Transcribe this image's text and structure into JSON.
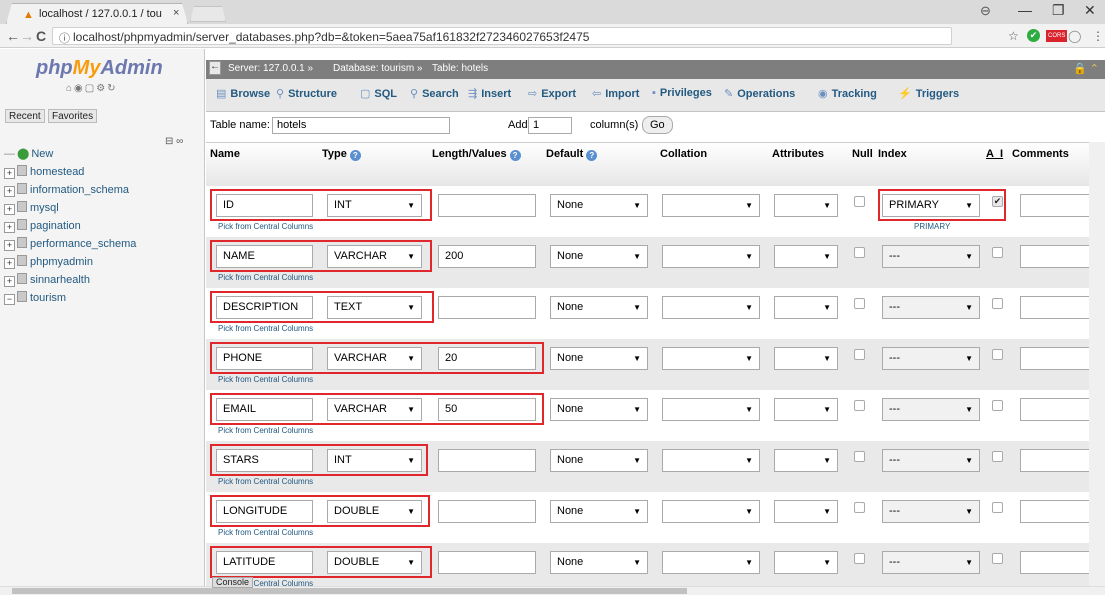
{
  "browser": {
    "tab_title": "localhost / 127.0.0.1 / tou",
    "tab_close": "×",
    "url": "localhost/phpmyadmin/server_databases.php?db=&token=5aea75af161832f272346027653f2475",
    "controls": {
      "account": "⊖",
      "minimize": "—",
      "maximize": "❐",
      "close": "✕"
    },
    "nav": {
      "back": "←",
      "forward": "→",
      "reload": "C",
      "info": "ⓘ"
    },
    "ext": {
      "star": "☆",
      "check": "✔",
      "badge": "CORS",
      "shield": "◯",
      "menu": "⋮"
    }
  },
  "left": {
    "logo_php": "php",
    "logo_my": "My",
    "logo_admin": "Admin",
    "icons": "⌂◉▢⚙↻",
    "recent": "Recent",
    "favorites": "Favorites",
    "collapse": "⊟ ∞",
    "tree": [
      {
        "label": "New",
        "exp": "",
        "icon": "new"
      },
      {
        "label": "homestead",
        "exp": "+"
      },
      {
        "label": "information_schema",
        "exp": "+"
      },
      {
        "label": "mysql",
        "exp": "+"
      },
      {
        "label": "pagination",
        "exp": "+"
      },
      {
        "label": "performance_schema",
        "exp": "+"
      },
      {
        "label": "phpmyadmin",
        "exp": "+"
      },
      {
        "label": "sinnarhealth",
        "exp": "+"
      },
      {
        "label": "tourism",
        "exp": "−"
      }
    ]
  },
  "topnav": {
    "collapse": "←",
    "server": "Server: 127.0.0.1 »",
    "database": "Database: tourism »",
    "table": "Table: hotels",
    "icons": "🔒 ⌃"
  },
  "tabs": [
    {
      "label": "Browse",
      "icon": "▤"
    },
    {
      "label": "Structure",
      "icon": "⚲"
    },
    {
      "label": "SQL",
      "icon": "▢"
    },
    {
      "label": "Search",
      "icon": "⚲"
    },
    {
      "label": "Insert",
      "icon": "⇶"
    },
    {
      "label": "Export",
      "icon": "⇨"
    },
    {
      "label": "Import",
      "icon": "⇦"
    },
    {
      "label": "Privileges",
      "icon": "▪"
    },
    {
      "label": "Operations",
      "icon": "✎"
    },
    {
      "label": "Tracking",
      "icon": "◉"
    },
    {
      "label": "Triggers",
      "icon": "⚡"
    }
  ],
  "form": {
    "table_name_label": "Table name:",
    "table_name_value": "hotels",
    "add_label": "Add",
    "add_value": "1",
    "columns_label": "column(s)",
    "go_label": "Go"
  },
  "headers": {
    "name": "Name",
    "type": "Type",
    "length": "Length/Values",
    "default": "Default",
    "collation": "Collation",
    "attributes": "Attributes",
    "null": "Null",
    "index": "Index",
    "ai": "A_I",
    "comments": "Comments",
    "help": "?"
  },
  "pick_label": "Pick from Central Columns",
  "primary_sub": "PRIMARY",
  "arrow": "▼",
  "console_label": "Console",
  "rows": [
    {
      "name": "ID",
      "type": "INT",
      "length": "",
      "default": "None",
      "collation": "",
      "attributes": "",
      "index": "PRIMARY",
      "ai": "✔"
    },
    {
      "name": "NAME",
      "type": "VARCHAR",
      "length": "200",
      "default": "None",
      "collation": "",
      "attributes": "",
      "index": "---",
      "ai": ""
    },
    {
      "name": "DESCRIPTION",
      "type": "TEXT",
      "length": "",
      "default": "None",
      "collation": "",
      "attributes": "",
      "index": "---",
      "ai": ""
    },
    {
      "name": "PHONE",
      "type": "VARCHAR",
      "length": "20",
      "default": "None",
      "collation": "",
      "attributes": "",
      "index": "---",
      "ai": ""
    },
    {
      "name": "EMAIL",
      "type": "VARCHAR",
      "length": "50",
      "default": "None",
      "collation": "",
      "attributes": "",
      "index": "---",
      "ai": ""
    },
    {
      "name": "STARS",
      "type": "INT",
      "length": "",
      "default": "None",
      "collation": "",
      "attributes": "",
      "index": "---",
      "ai": ""
    },
    {
      "name": "LONGITUDE",
      "type": "DOUBLE",
      "length": "",
      "default": "None",
      "collation": "",
      "attributes": "",
      "index": "---",
      "ai": ""
    },
    {
      "name": "LATITUDE",
      "type": "DOUBLE",
      "length": "",
      "default": "None",
      "collation": "",
      "attributes": "",
      "index": "---",
      "ai": ""
    }
  ]
}
